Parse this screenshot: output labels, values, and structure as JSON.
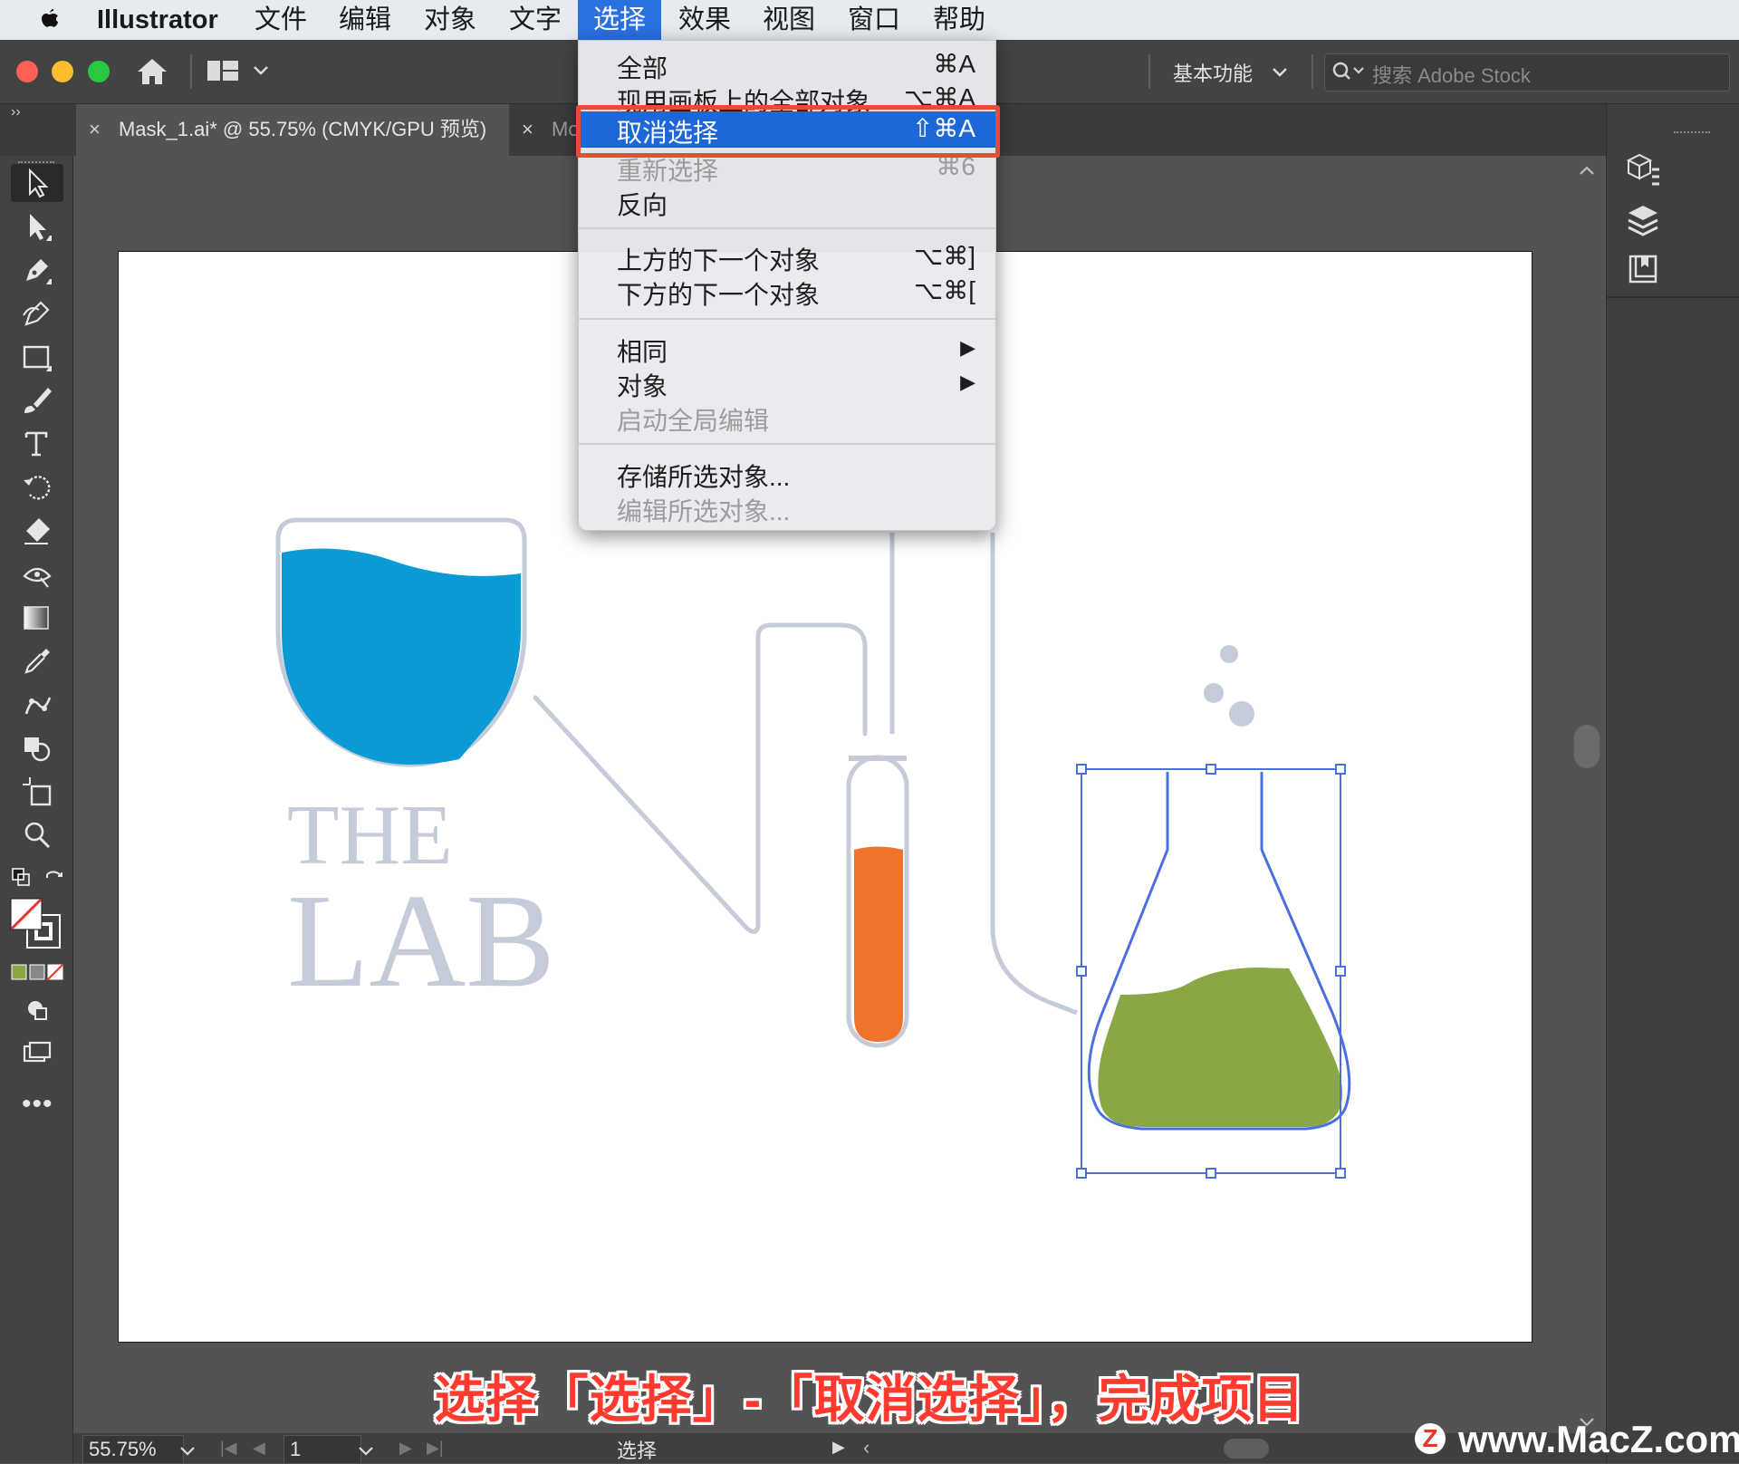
{
  "menubar": {
    "app_name": "Illustrator",
    "items": [
      "文件",
      "编辑",
      "对象",
      "文字",
      "选择",
      "效果",
      "视图",
      "窗口",
      "帮助"
    ],
    "active_item": "选择"
  },
  "appbar": {
    "workspace_label": "基本功能",
    "search_placeholder": "搜索 Adobe Stock"
  },
  "tabs": [
    {
      "close": "×",
      "label": "Mask_1.ai* @ 55.75% (CMYK/GPU 预览)"
    },
    {
      "close": "×",
      "label": "Mo"
    }
  ],
  "select_menu": {
    "items": [
      {
        "label": "全部",
        "shortcut": "⌘A",
        "enabled": true
      },
      {
        "label": "现用画板上的全部对象",
        "shortcut": "⌥⌘A",
        "enabled": true
      },
      {
        "label": "取消选择",
        "shortcut": "⇧⌘A",
        "enabled": true,
        "highlighted": true
      },
      {
        "label": "重新选择",
        "shortcut": "⌘6",
        "enabled": false
      },
      {
        "label": "反向",
        "shortcut": "",
        "enabled": true
      },
      {
        "label": "上方的下一个对象",
        "shortcut": "⌥⌘]",
        "enabled": true
      },
      {
        "label": "下方的下一个对象",
        "shortcut": "⌥⌘[",
        "enabled": true
      },
      {
        "label": "相同",
        "shortcut": "▶",
        "enabled": true
      },
      {
        "label": "对象",
        "shortcut": "▶",
        "enabled": true
      },
      {
        "label": "启动全局编辑",
        "shortcut": "",
        "enabled": false
      },
      {
        "label": "存储所选对象...",
        "shortcut": "",
        "enabled": true
      },
      {
        "label": "编辑所选对象...",
        "shortcut": "",
        "enabled": false
      }
    ]
  },
  "artwork": {
    "logo_line1": "THE",
    "logo_line2": "LAB"
  },
  "statusbar": {
    "zoom": "55.75%",
    "artboard_number": "1",
    "current_tool": "选择"
  },
  "caption": "选择「选择」-「取消选择」，完成项目",
  "watermark": {
    "logo": "Z",
    "text": "www.MacZ.com"
  },
  "colors": {
    "menu_highlight": "#1d67d8",
    "annotation_red": "#e84b3c",
    "water_blue": "#0a9bd6",
    "liquid_orange": "#f0732b",
    "liquid_green": "#8aa745",
    "glass_outline": "#c5cbd9",
    "selection_blue": "#4a6fe0"
  },
  "icons": [
    "apple-icon",
    "home-icon",
    "arrange-documents-icon",
    "chevron-down-icon",
    "search-icon",
    "selection-tool-icon",
    "direct-selection-tool-icon",
    "pen-tool-icon",
    "curvature-tool-icon",
    "rectangle-tool-icon",
    "paintbrush-tool-icon",
    "type-tool-icon",
    "rotate-tool-icon",
    "eraser-tool-icon",
    "width-tool-icon",
    "gradient-tool-icon",
    "eyedropper-tool-icon",
    "puppet-warp-tool-icon",
    "shape-builder-tool-icon",
    "artboard-tool-icon",
    "zoom-tool-icon",
    "properties-panel-icon",
    "layers-panel-icon",
    "libraries-panel-icon"
  ]
}
